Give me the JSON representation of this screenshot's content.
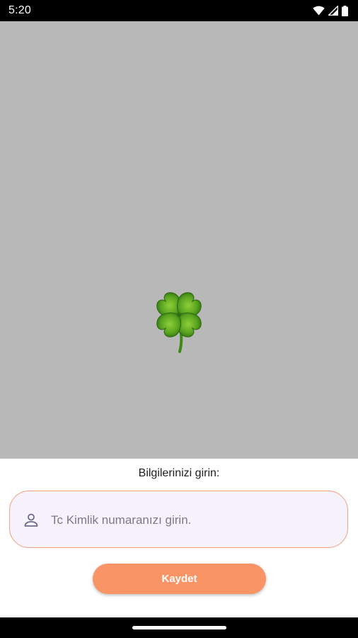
{
  "status_bar": {
    "time": "5:20",
    "icons": [
      "wifi-icon",
      "signal-icon",
      "battery-icon"
    ]
  },
  "hero": {
    "background_color": "#b8b8b8",
    "image_icon": "four-leaf-clover-icon"
  },
  "form": {
    "title": "Bilgilerinizi girin:",
    "tc_field": {
      "value": "",
      "placeholder": "Tc Kimlik numaranızı girin.",
      "icon": "person-icon",
      "border_color": "#f3a07f",
      "background_color": "#f6f2fb"
    },
    "save_button": {
      "label": "Kaydet",
      "color": "#f99466"
    }
  }
}
